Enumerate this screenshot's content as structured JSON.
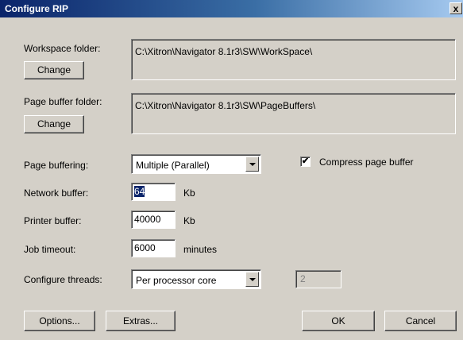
{
  "window": {
    "title": "Configure RIP",
    "close_glyph": "x"
  },
  "workspace": {
    "label": "Workspace folder:",
    "path": "C:\\Xitron\\Navigator 8.1r3\\SW\\WorkSpace\\",
    "change_label": "Change"
  },
  "page_buffer_folder": {
    "label": "Page buffer folder:",
    "path": "C:\\Xitron\\Navigator 8.1r3\\SW\\PageBuffers\\",
    "change_label": "Change"
  },
  "page_buffering": {
    "label": "Page buffering:",
    "selected": "Multiple (Parallel)"
  },
  "compress": {
    "label": "Compress page buffer",
    "checked": true,
    "check_glyph": "✔"
  },
  "network_buffer": {
    "label": "Network buffer:",
    "value": "64",
    "unit": "Kb"
  },
  "printer_buffer": {
    "label": "Printer buffer:",
    "value": "40000",
    "unit": "Kb"
  },
  "job_timeout": {
    "label": "Job timeout:",
    "value": "6000",
    "unit": "minutes"
  },
  "threads": {
    "label": "Configure threads:",
    "selected": "Per processor core",
    "count": "2"
  },
  "buttons": {
    "options": "Options...",
    "extras": "Extras...",
    "ok": "OK",
    "cancel": "Cancel"
  },
  "colors": {
    "dialog_bg": "#d4d0c8",
    "title_start": "#0a246a",
    "title_end": "#a6caf0",
    "selection": "#0a246a"
  }
}
